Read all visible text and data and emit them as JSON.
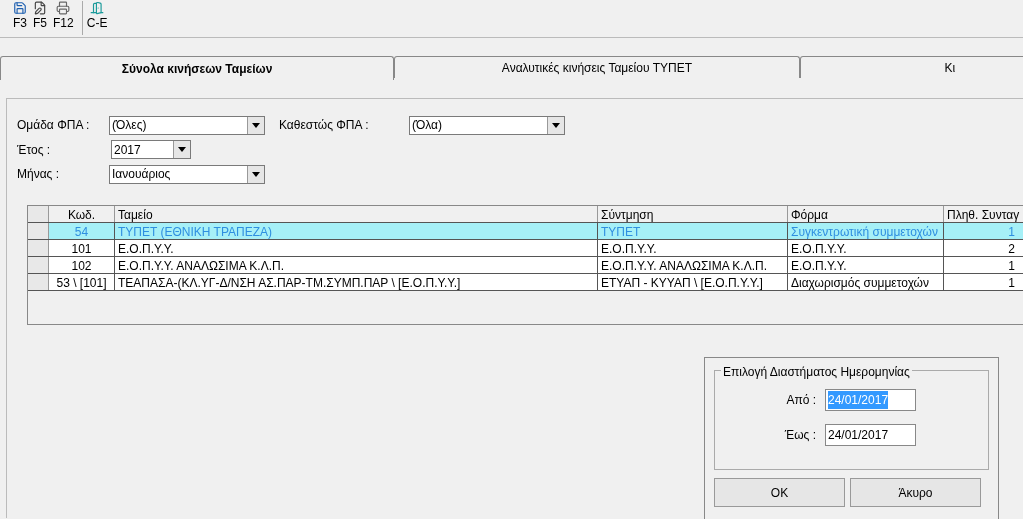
{
  "toolbar": [
    {
      "kind": "save",
      "label": "F3"
    },
    {
      "kind": "edit",
      "label": "F5"
    },
    {
      "kind": "print",
      "label": "F12"
    },
    {
      "kind": "exit",
      "label": "C-E"
    }
  ],
  "tabs": [
    {
      "label": "Σύνολα κινήσεων Ταμείων",
      "selected": true
    },
    {
      "label": "Αναλυτικές κινήσεις Ταμείου ΤΥΠΕΤ",
      "selected": false
    },
    {
      "label": "Κι",
      "selected": false
    }
  ],
  "filters": {
    "vat_group": {
      "label": "Ομάδα ΦΠΑ :",
      "value": "(Όλες)"
    },
    "vat_status": {
      "label": "Καθεστώς ΦΠΑ :",
      "value": "(Όλα)"
    },
    "year": {
      "label": "Έτος :",
      "value": "2017"
    },
    "month": {
      "label": "Μήνας :",
      "value": "Ιανουάριος"
    }
  },
  "table": {
    "columns": [
      "Κωδ.",
      "Ταμείο",
      "Σύντμηση",
      "Φόρμα",
      "Πληθ. Συνταγ"
    ],
    "rows": [
      {
        "cells": [
          "54",
          "ΤΥΠΕΤ (ΕΘΝΙΚΗ ΤΡΑΠΕΖΑ)",
          "ΤΥΠΕΤ",
          "Συγκεντρωτική συμμετοχών",
          "1"
        ],
        "selected": true
      },
      {
        "cells": [
          "101",
          "Ε.Ο.Π.Υ.Υ.",
          "Ε.Ο.Π.Υ.Υ.",
          "Ε.Ο.Π.Υ.Υ.",
          "2"
        ],
        "selected": false
      },
      {
        "cells": [
          "102",
          "Ε.Ο.Π.Υ.Υ. ΑΝΑΛΩΣΙΜΑ Κ.Λ.Π.",
          "Ε.Ο.Π.Υ.Υ. ΑΝΑΛΩΣΙΜΑ Κ.Λ.Π.",
          "Ε.Ο.Π.Υ.Υ.",
          "1"
        ],
        "selected": false
      },
      {
        "cells": [
          "53 \\ [101]",
          "ΤΕΑΠΑΣΑ-(ΚΛ.ΥΓ-Δ/ΝΣΗ ΑΣ.ΠΑΡ-ΤΜ.ΣΥΜΠ.ΠΑΡ  \\ [Ε.Ο.Π.Υ.Υ.]",
          "ΕΤΥΑΠ - ΚΥΥΑΠ \\ [Ε.Ο.Π.Υ.Υ.]",
          "Διαχωρισμός συμμετοχών",
          "1"
        ],
        "selected": false
      }
    ]
  },
  "date_dialog": {
    "group_title": "Επιλογή Διαστήματος Ημερομηνίας",
    "from": {
      "label": "Από :",
      "value": "24/01/2017",
      "selected": true
    },
    "to": {
      "label": "Έως :",
      "value": "24/01/2017",
      "selected": false
    },
    "buttons": [
      "OK",
      "Άκυρο"
    ]
  }
}
